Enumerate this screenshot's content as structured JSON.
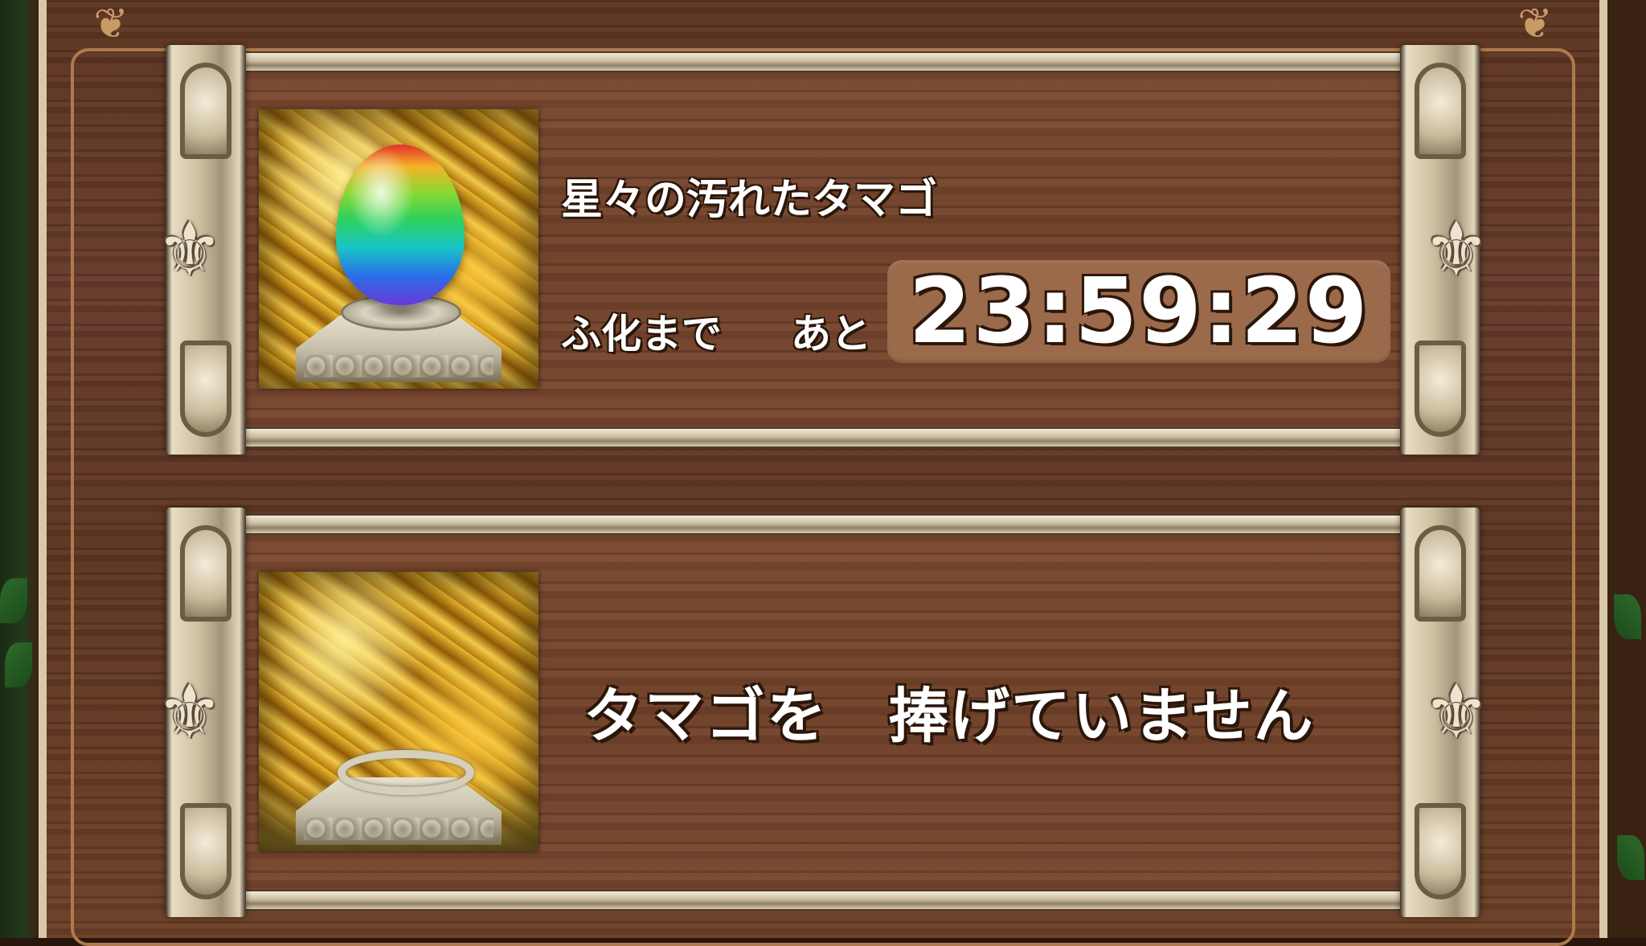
{
  "slots": [
    {
      "egg_name": "星々の汚れたタマゴ",
      "hatch_label": "ふ化まで",
      "remain_label": "あと",
      "timer": "23:59:29",
      "image_icon": "rainbow-egg-on-pedestal"
    },
    {
      "message": "タマゴを　捧げていません",
      "image_icon": "empty-golden-nest-pedestal"
    }
  ],
  "colors": {
    "wood": "#6d3f28",
    "frame": "#d9ccb1",
    "timer_box": "#9b6a4b",
    "text": "#ffffff",
    "text_outline": "#2b160a"
  }
}
